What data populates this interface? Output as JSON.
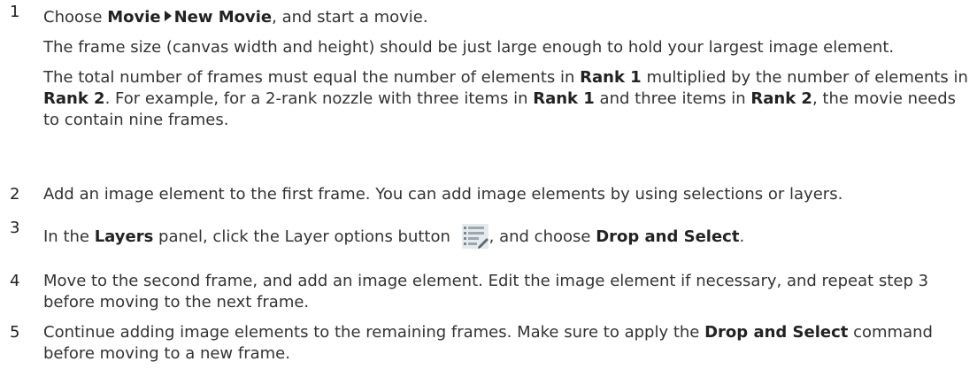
{
  "steps": [
    {
      "number": "1",
      "line1": {
        "pre": "Choose ",
        "menu1": "Movie",
        "menu2": "New Movie",
        "post": ", and start a movie."
      },
      "para2": "The frame size (canvas width and height) should be just large enough to hold your largest image element.",
      "para3": {
        "t1": "The total number of frames must equal the number of elements in ",
        "b1": "Rank 1",
        "t2": " multiplied by the number of elements in ",
        "b2": "Rank 2",
        "t3": ". For example, for a 2-rank nozzle with three items in ",
        "b3": "Rank 1",
        "t4": " and three items in ",
        "b4": "Rank 2",
        "t5": ", the movie needs to contain nine frames."
      }
    },
    {
      "number": "2",
      "text": "Add an image element to the first frame. You can add image elements by using selections or layers."
    },
    {
      "number": "3",
      "pre": "In the ",
      "b1": "Layers",
      "mid": " panel, click the Layer options button ",
      "icon": "layer-options-icon",
      "mid2": ", and choose ",
      "b2": "Drop and Select",
      "post": "."
    },
    {
      "number": "4",
      "text": "Move to the second frame, and add an image element. Edit the image element if necessary, and repeat step 3 before moving to the next frame."
    },
    {
      "number": "5",
      "pre": "Continue adding image elements to the remaining frames. Make sure to apply the ",
      "b1": "Drop and Select",
      "post": " command before moving to a new frame."
    }
  ],
  "colors": {
    "text": "#333333",
    "emphasis": "#222222",
    "icon_fill": "#cfd8dc"
  }
}
